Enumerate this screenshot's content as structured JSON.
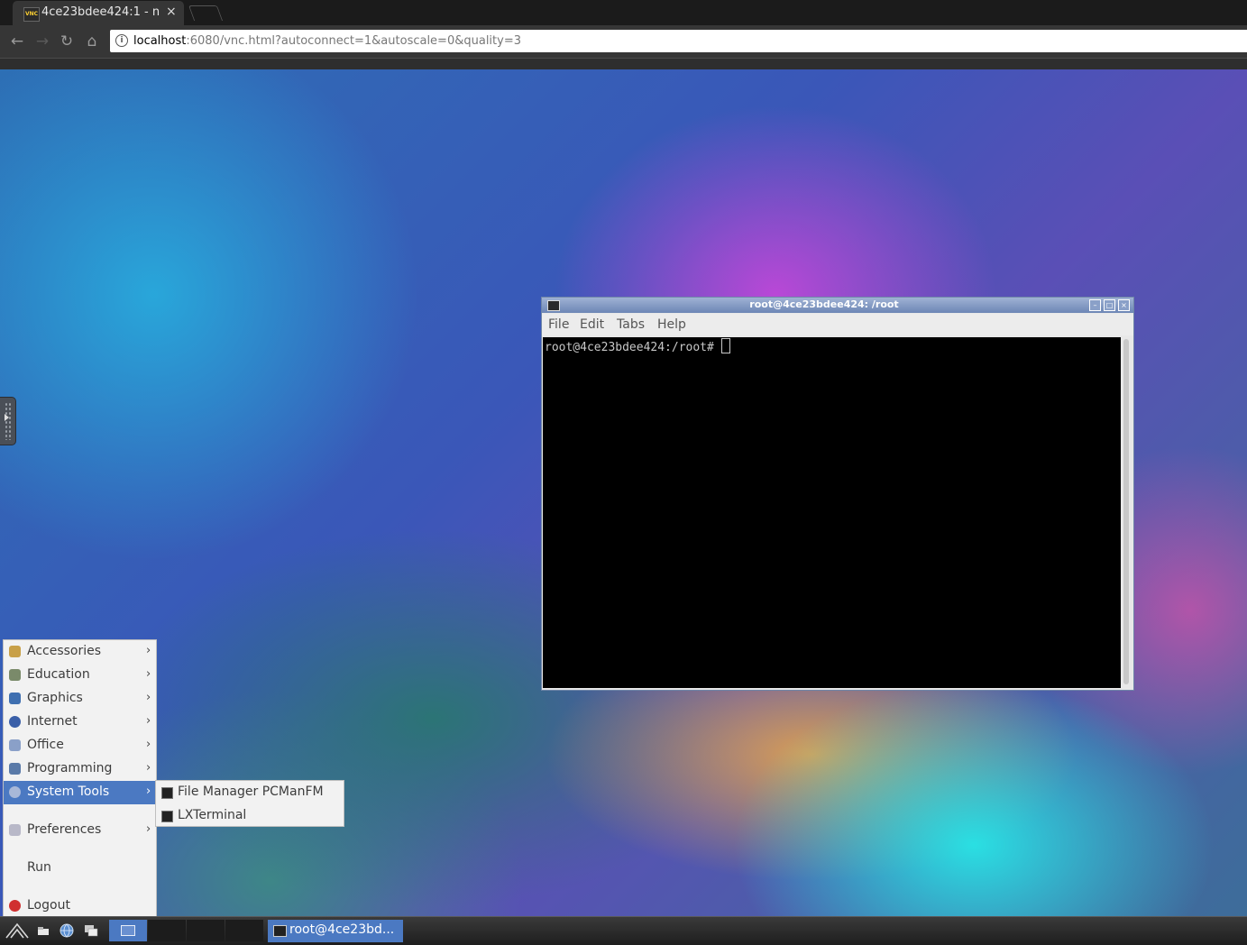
{
  "browser": {
    "tab_title": "4ce23bdee424:1 - n",
    "tab_close": "×",
    "favicon_text": "VNC",
    "url_host": "localhost",
    "url_rest": ":6080/vnc.html?autoconnect=1&autoscale=0&quality=3",
    "nav": {
      "back": "←",
      "forward": "→",
      "reload": "↻",
      "home": "⌂"
    }
  },
  "terminal": {
    "title": "root@4ce23bdee424: /root",
    "menu": [
      "File",
      "Edit",
      "Tabs",
      "Help"
    ],
    "prompt": "root@4ce23bdee424:/root# ",
    "controls": {
      "minimize": "–",
      "maximize": "□",
      "close": "×"
    }
  },
  "main_menu": {
    "items": [
      {
        "label": "Accessories",
        "icon": "accessories-icon",
        "color": "#c8a048",
        "has_submenu": true
      },
      {
        "label": "Education",
        "icon": "education-icon",
        "color": "#7a8a6a",
        "has_submenu": true
      },
      {
        "label": "Graphics",
        "icon": "graphics-icon",
        "color": "#3f6fb0",
        "has_submenu": true
      },
      {
        "label": "Internet",
        "icon": "internet-icon",
        "color": "#3a5fa8",
        "has_submenu": true
      },
      {
        "label": "Office",
        "icon": "office-icon",
        "color": "#8aa0c8",
        "has_submenu": true
      },
      {
        "label": "Programming",
        "icon": "programming-icon",
        "color": "#5a7aa8",
        "has_submenu": true
      },
      {
        "label": "System Tools",
        "icon": "system-tools-icon",
        "color": "#a8b8d8",
        "has_submenu": true,
        "active": true
      },
      {
        "label": "Preferences",
        "icon": "preferences-icon",
        "color": "#b8b8c8",
        "has_submenu": true
      },
      {
        "label": "Run",
        "icon": "",
        "has_submenu": false
      },
      {
        "label": "Logout",
        "icon": "logout-icon",
        "color": "#d03030",
        "has_submenu": false
      }
    ],
    "chevron": "›"
  },
  "sub_menu": {
    "items": [
      {
        "label": "File Manager PCManFM",
        "icon": "file-manager-icon"
      },
      {
        "label": "LXTerminal",
        "icon": "terminal-icon"
      }
    ]
  },
  "taskbar": {
    "task_label": "root@4ce23bd...",
    "accent": "#4b79c2"
  }
}
